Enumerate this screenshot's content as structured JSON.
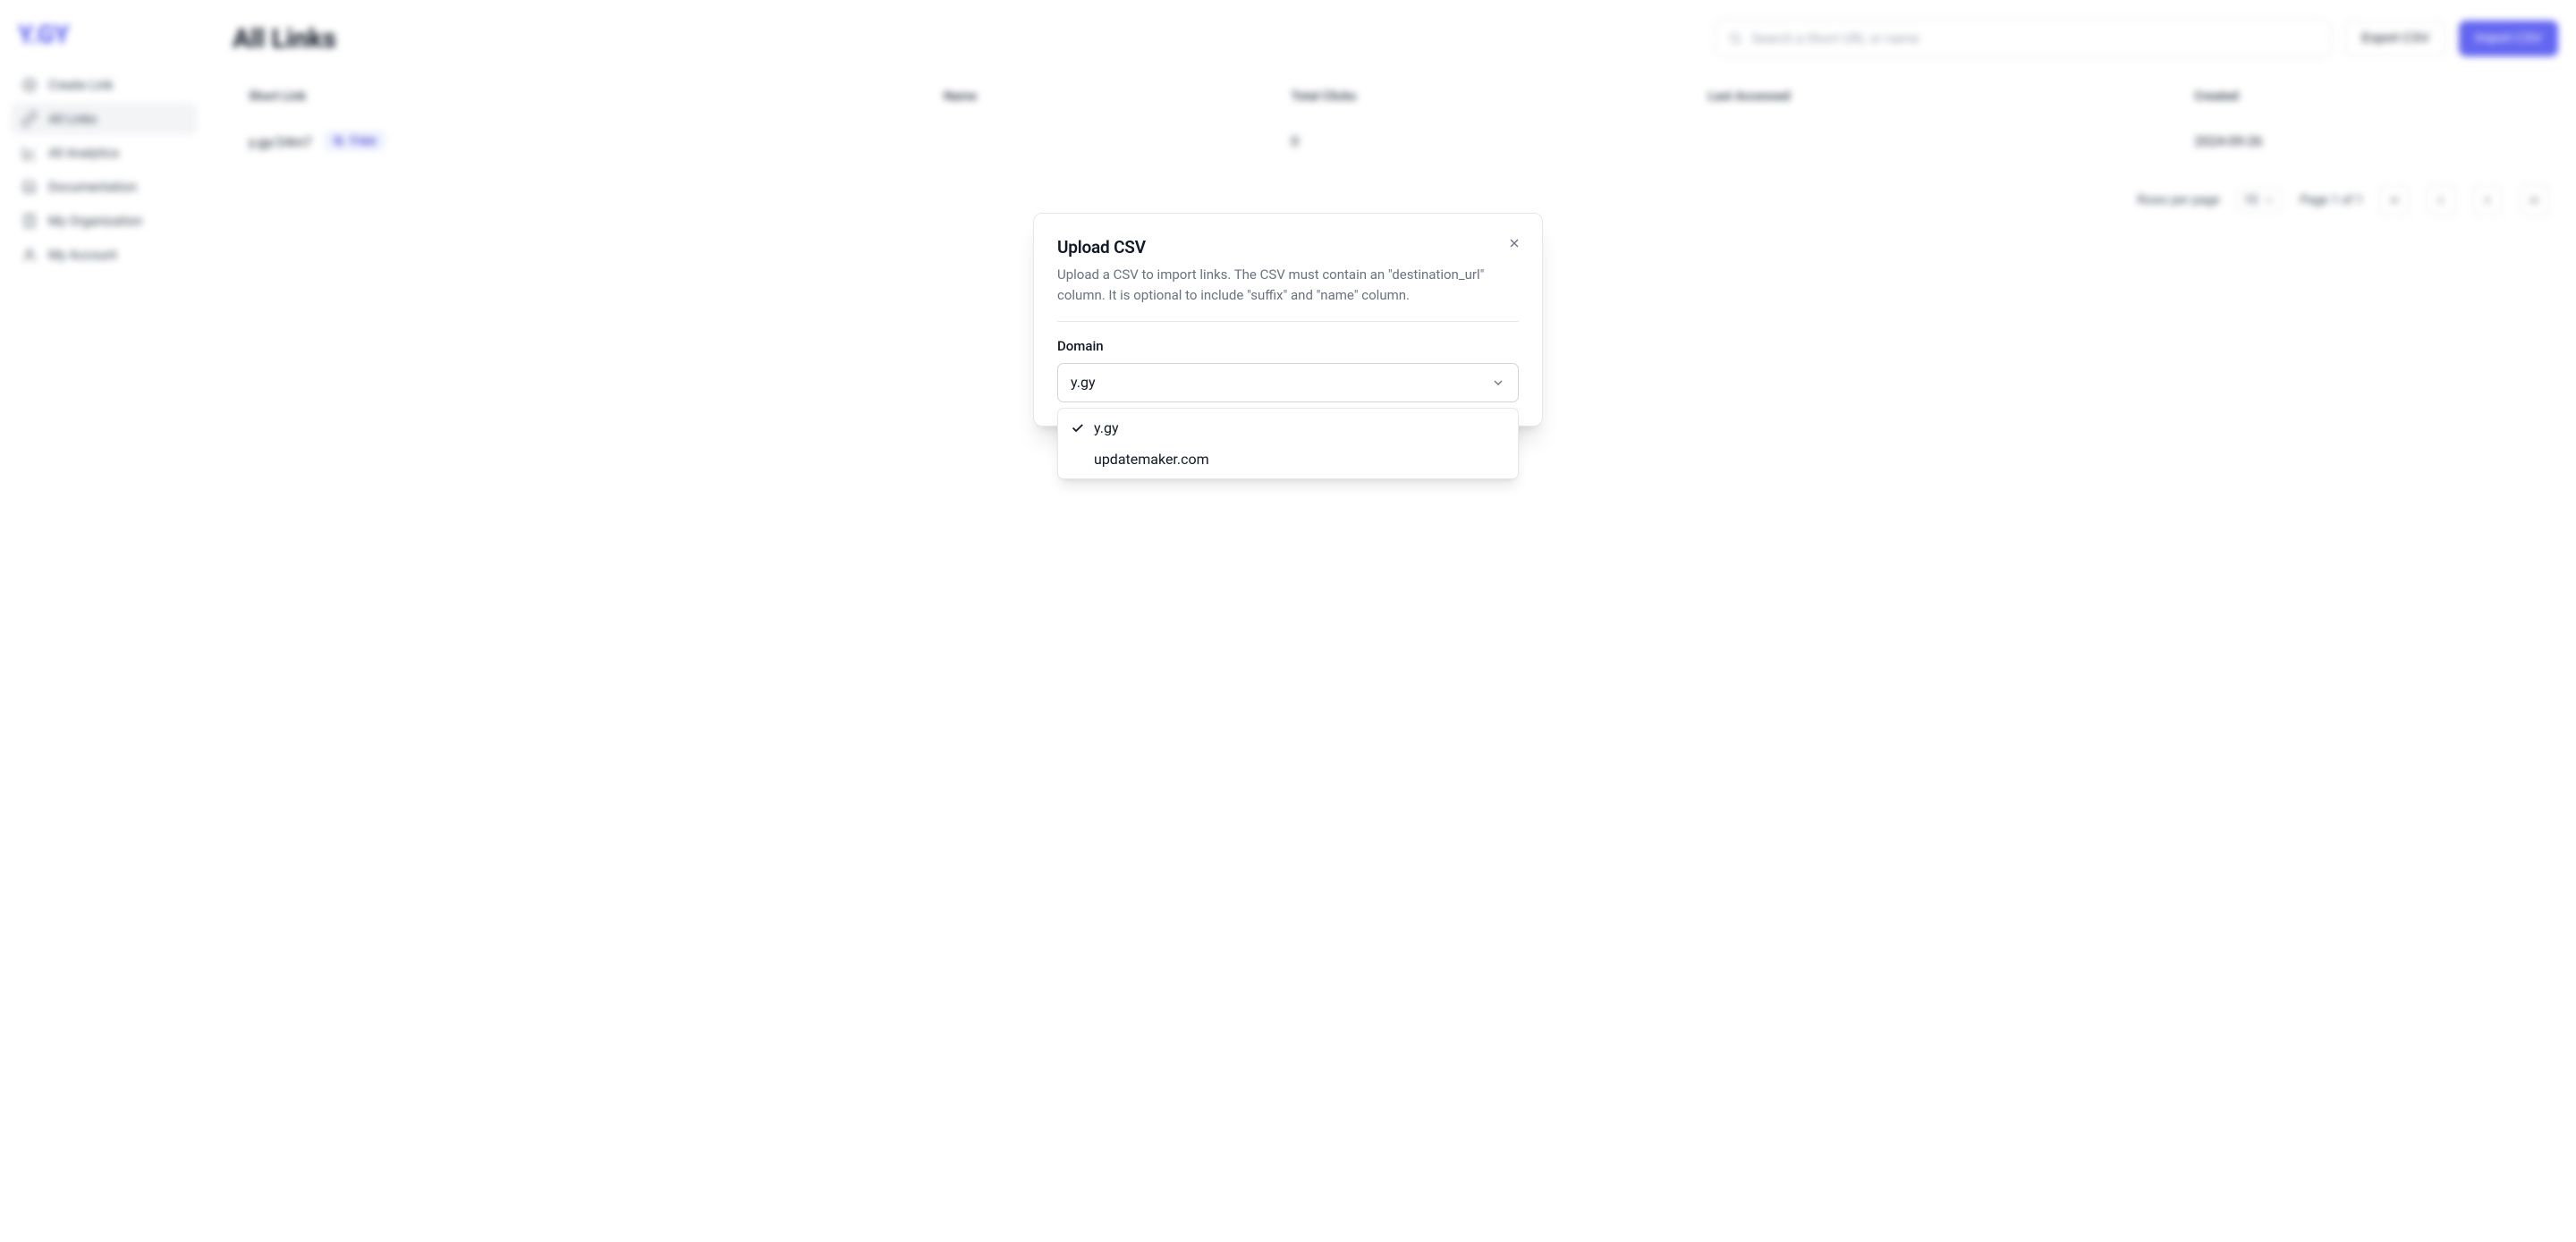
{
  "brand": "Y.GY",
  "sidebar": {
    "items": [
      {
        "label": "Create Link"
      },
      {
        "label": "All Links"
      },
      {
        "label": "All Analytics"
      },
      {
        "label": "Documentation"
      },
      {
        "label": "My Organization"
      },
      {
        "label": "My Account"
      }
    ]
  },
  "header": {
    "title": "All Links",
    "search_placeholder": "Search a Short URL or name",
    "export_label": "Export CSV",
    "import_label": "Import CSV"
  },
  "table": {
    "columns": [
      "Short Link",
      "Name",
      "Total Clicks",
      "Last Accessed",
      "Created"
    ],
    "rows": [
      {
        "short_link": "y.gy/24m7",
        "copy_label": "Copy",
        "name": "",
        "total_clicks": "0",
        "last_accessed": "",
        "created": "2024-09-26"
      }
    ]
  },
  "pager": {
    "rows_label": "Rows per page",
    "rows_value": "10",
    "page_text": "Page 1 of 1"
  },
  "modal": {
    "title": "Upload CSV",
    "description": "Upload a CSV to import links. The CSV must contain an \"destination_url\" column. It is optional to include \"suffix\" and \"name\" column.",
    "domain_label": "Domain",
    "domain_selected": "y.gy",
    "domain_options": [
      {
        "label": "y.gy",
        "selected": true
      },
      {
        "label": "updatemaker.com",
        "selected": false
      }
    ]
  }
}
